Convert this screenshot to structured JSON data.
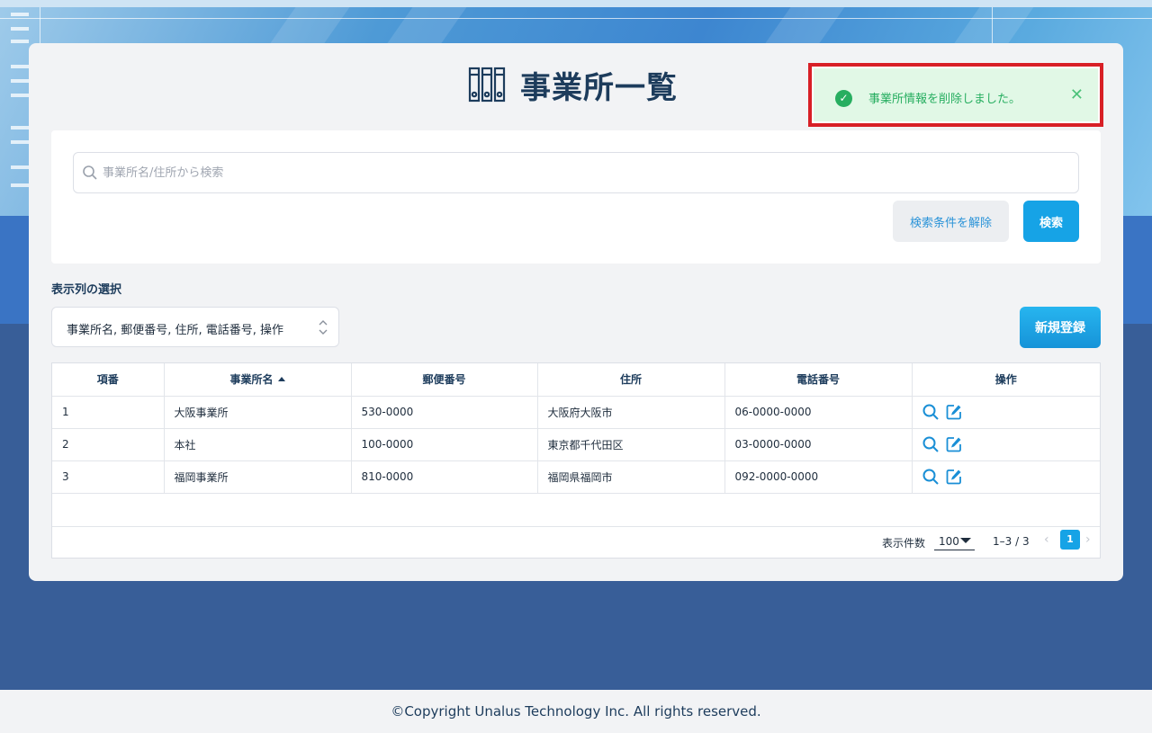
{
  "page": {
    "title": "事業所一覧"
  },
  "toast": {
    "message": "事業所情報を削除しました。",
    "color": "#27ae60"
  },
  "search": {
    "placeholder": "事業所名/住所から検索",
    "value": "",
    "clear_label": "検索条件を解除",
    "search_label": "検索"
  },
  "columns": {
    "label": "表示列の選択",
    "selected": "事業所名, 郵便番号, 住所, 電話番号, 操作"
  },
  "actions": {
    "new_label": "新規登録"
  },
  "table": {
    "headers": [
      "項番",
      "事業所名",
      "郵便番号",
      "住所",
      "電話番号",
      "操作"
    ],
    "sorted_column": "事業所名",
    "sort_direction": "asc",
    "rows": [
      {
        "no": "1",
        "name": "大阪事業所",
        "zip": "530-0000",
        "address": "大阪府大阪市",
        "phone": "06-0000-0000"
      },
      {
        "no": "2",
        "name": "本社",
        "zip": "100-0000",
        "address": "東京都千代田区",
        "phone": "03-0000-0000"
      },
      {
        "no": "3",
        "name": "福岡事業所",
        "zip": "810-0000",
        "address": "福岡県福岡市",
        "phone": "092-0000-0000"
      }
    ],
    "row_icons": [
      "search-icon",
      "edit-icon"
    ]
  },
  "pagination": {
    "page_size_label": "表示件数",
    "page_size": "100",
    "range": "1–3 / 3",
    "current_page": "1"
  },
  "footer": {
    "text": "©Copyright Unalus Technology Inc. All rights reserved."
  },
  "colors": {
    "accent": "#16a3e6",
    "title": "#1d3c5c",
    "background": "#385e98",
    "toast_border": "#d81f26"
  }
}
